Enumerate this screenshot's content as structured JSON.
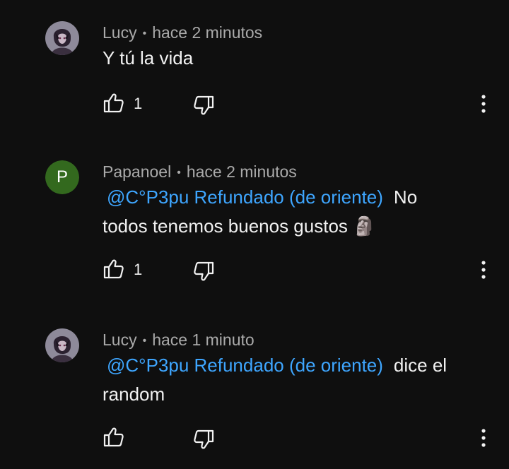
{
  "comments": [
    {
      "author": "Lucy",
      "time": "hace 2 minutos",
      "mention": "",
      "text_line1": "Y tú la vida",
      "text_line2": "",
      "likes": "1",
      "avatar": "anime-avatar"
    },
    {
      "author": "Papanoel",
      "time": "hace 2 minutos",
      "mention": "@C°P3pu Refundado (de oriente)",
      "text_line1": "No",
      "text_line2": "todos tenemos buenos gustos 🗿",
      "likes": "1",
      "avatar_letter": "P",
      "avatar_color": "#33691e"
    },
    {
      "author": "Lucy",
      "time": "hace 1 minuto",
      "mention": "@C°P3pu Refundado (de oriente)",
      "text_line1": "dice el",
      "text_line2": "random",
      "likes": "",
      "avatar": "anime-avatar"
    }
  ],
  "colors": {
    "background": "#0f0f0f",
    "mention": "#3ea6ff",
    "meta": "#aaaaaa"
  },
  "icons": [
    "like-icon",
    "dislike-icon",
    "more-vertical-icon"
  ]
}
